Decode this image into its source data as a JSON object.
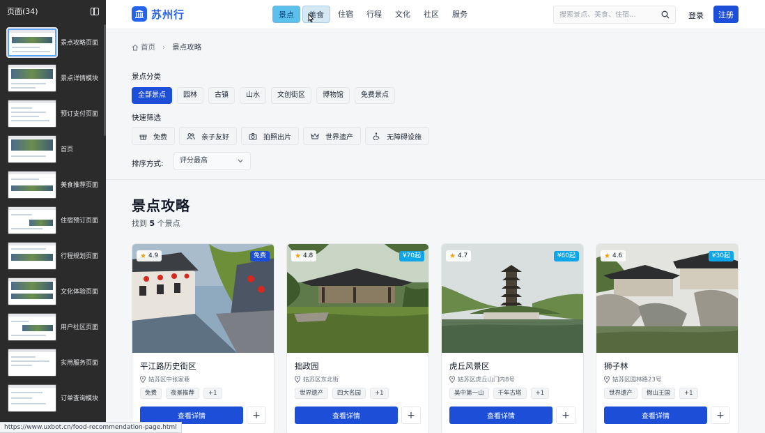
{
  "left_panel": {
    "title": "页面(34)",
    "pages": [
      {
        "label": "景点攻略页面",
        "active": true
      },
      {
        "label": "景点详情模块",
        "active": false
      },
      {
        "label": "预订支付页面",
        "active": false
      },
      {
        "label": "首页",
        "active": false
      },
      {
        "label": "美食推荐页面",
        "active": false
      },
      {
        "label": "住宿预订页面",
        "active": false
      },
      {
        "label": "行程规划页面",
        "active": false
      },
      {
        "label": "文化体验页面",
        "active": false
      },
      {
        "label": "用户社区页面",
        "active": false
      },
      {
        "label": "实用服务页面",
        "active": false
      },
      {
        "label": "订单查询模块",
        "active": false
      }
    ]
  },
  "header": {
    "logo_text": "苏州行",
    "nav": [
      "景点",
      "美食",
      "住宿",
      "行程",
      "文化",
      "社区",
      "服务"
    ],
    "active_nav": "景点",
    "hover_nav": "美食",
    "search_placeholder": "搜索景点、美食、住宿...",
    "login_label": "登录",
    "register_label": "注册"
  },
  "breadcrumb": {
    "home": "首页",
    "current": "景点攻略"
  },
  "filters": {
    "category_title": "景点分类",
    "categories": [
      "全部景点",
      "园林",
      "古镇",
      "山水",
      "文创街区",
      "博物馆",
      "免费景点"
    ],
    "active_category": "全部景点",
    "quick_title": "快速筛选",
    "quick": [
      {
        "label": "免费",
        "icon": "gift-icon"
      },
      {
        "label": "亲子友好",
        "icon": "users-icon"
      },
      {
        "label": "拍照出片",
        "icon": "camera-icon"
      },
      {
        "label": "世界遗产",
        "icon": "crown-icon"
      },
      {
        "label": "无障碍设施",
        "icon": "accessibility-icon"
      }
    ],
    "sort_label": "排序方式:",
    "sort_value": "评分最高"
  },
  "results": {
    "title": "景点攻略",
    "count_prefix": "找到",
    "count": "5",
    "count_suffix": "个景点"
  },
  "cards": [
    {
      "name": "平江路历史街区",
      "address": "姑苏区中张家巷",
      "rating": "4.9",
      "price": "免费",
      "tags": [
        "免费",
        "夜景推荐",
        "+1"
      ],
      "detail_label": "查看详情",
      "add_label": "+"
    },
    {
      "name": "拙政园",
      "address": "姑苏区东北街",
      "rating": "4.8",
      "price": "¥70起",
      "tags": [
        "世界遗产",
        "四大名园",
        "+1"
      ],
      "detail_label": "查看详情",
      "add_label": "+"
    },
    {
      "name": "虎丘风景区",
      "address": "姑苏区虎丘山门内8号",
      "rating": "4.7",
      "price": "¥60起",
      "tags": [
        "吴中第一山",
        "千年古塔",
        "+1"
      ],
      "detail_label": "查看详情",
      "add_label": "+"
    },
    {
      "name": "狮子林",
      "address": "姑苏区园林路23号",
      "rating": "4.6",
      "price": "¥30起",
      "tags": [
        "世界遗产",
        "假山王国",
        "+1"
      ],
      "detail_label": "查看详情",
      "add_label": "+"
    }
  ],
  "status_bar": {
    "url": "https://www.uxbot.cn/food-recommendation-page.html"
  },
  "colors": {
    "primary": "#1d4ed8",
    "active_nav": "#5bc0eb",
    "price_badge": "#0ea5e9",
    "star": "#f59e0b"
  }
}
